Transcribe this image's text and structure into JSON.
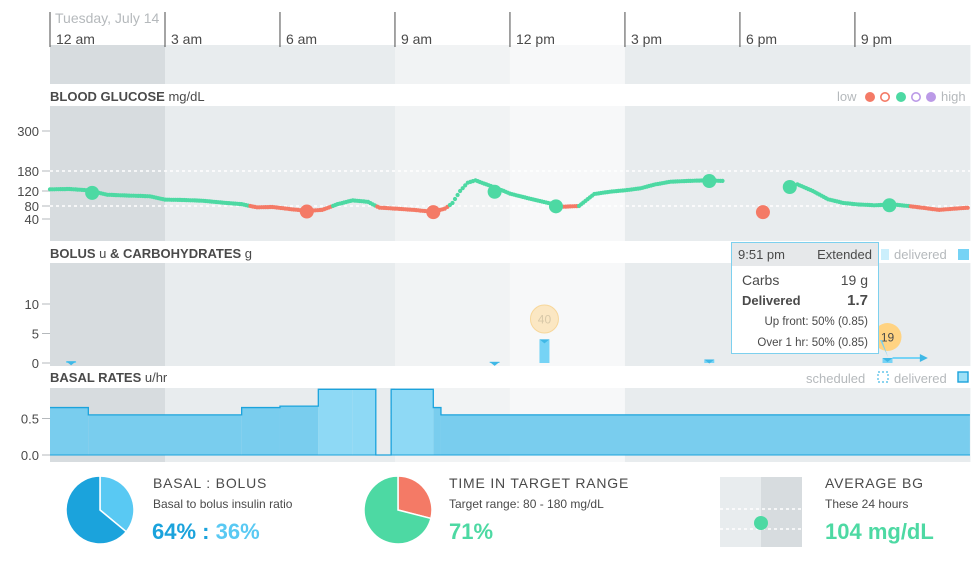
{
  "date": "Tuesday, July 14",
  "time_ticks": [
    "12 am",
    "3 am",
    "6 am",
    "9 am",
    "12 pm",
    "3 pm",
    "6 pm",
    "9 pm"
  ],
  "colors": {
    "in_range": "#4dd9a3",
    "low": "#f47a66",
    "high": "#bb9ae7",
    "bolus": "#76d3f5",
    "basal": "#66c6ea",
    "carbs": "#ffd382",
    "shade_dark": "#d7dcdf",
    "shade_mid": "#e8ecee",
    "shade_light": "#f1f3f4",
    "shade_lightest": "#f7f8f9"
  },
  "bg_panel": {
    "title": "BLOOD GLUCOSE",
    "unit": "mg/dL",
    "legend_low": "low",
    "legend_high": "high",
    "ticks": [
      "300",
      "180",
      "120",
      "80",
      "40"
    ]
  },
  "bolus_panel": {
    "title": "BOLUS",
    "unit_u": "u",
    "title2": "& CARBOHYDRATES",
    "unit_g": "g",
    "legend_delivered": "delivered",
    "ticks": [
      "10",
      "5",
      "0"
    ]
  },
  "basal_panel": {
    "title": "BASAL RATES",
    "unit": "u/hr",
    "legend_scheduled": "scheduled",
    "legend_delivered": "delivered",
    "ticks": [
      "0.5",
      "0.0"
    ]
  },
  "tooltip": {
    "time": "9:51 pm",
    "type": "Extended",
    "carbs_label": "Carbs",
    "carbs_value": "19 g",
    "delivered_label": "Delivered",
    "delivered_value": "1.7",
    "upfront": "Up front: 50% (0.85)",
    "over": "Over 1 hr: 50% (0.85)"
  },
  "stats": {
    "basal_bolus": {
      "title": "BASAL : BOLUS",
      "subtitle": "Basal to bolus insulin ratio",
      "basal_pct": "64%",
      "sep": " : ",
      "bolus_pct": "36%",
      "basal_value": 64,
      "bolus_value": 36
    },
    "target": {
      "title": "TIME IN TARGET RANGE",
      "subtitle": "Target range: 80 - 180 mg/dL",
      "value_text": "71%",
      "in_range": 71,
      "out_range": 29
    },
    "average": {
      "title": "AVERAGE BG",
      "subtitle": "These 24 hours",
      "value_text": "104 mg/dL",
      "value": 104
    }
  },
  "chart_data": [
    {
      "type": "scatter",
      "title": "BLOOD GLUCOSE mg/dL",
      "x_unit": "hours since 12 am",
      "ylim": [
        40,
        300
      ],
      "target_lines": [
        80,
        180
      ],
      "smbg": [
        {
          "x": 1.1,
          "y": 115,
          "cls": "target"
        },
        {
          "x": 6.7,
          "y": 63,
          "cls": "low"
        },
        {
          "x": 10.0,
          "y": 61,
          "cls": "low"
        },
        {
          "x": 11.6,
          "y": 118,
          "cls": "target"
        },
        {
          "x": 13.2,
          "y": 79,
          "cls": "target"
        },
        {
          "x": 17.2,
          "y": 150,
          "cls": "target"
        },
        {
          "x": 18.6,
          "y": 61,
          "cls": "low"
        },
        {
          "x": 19.3,
          "y": 132,
          "cls": "target"
        },
        {
          "x": 21.9,
          "y": 82,
          "cls": "target"
        }
      ],
      "cbg": [
        {
          "x": 0.0,
          "y": 125
        },
        {
          "x": 0.5,
          "y": 126
        },
        {
          "x": 1.0,
          "y": 122
        },
        {
          "x": 1.5,
          "y": 110
        },
        {
          "x": 2.0,
          "y": 108
        },
        {
          "x": 2.6,
          "y": 106
        },
        {
          "x": 3.0,
          "y": 97
        },
        {
          "x": 3.5,
          "y": 96
        },
        {
          "x": 4.0,
          "y": 94
        },
        {
          "x": 4.5,
          "y": 89
        },
        {
          "x": 5.0,
          "y": 85
        },
        {
          "x": 5.4,
          "y": 76
        },
        {
          "x": 5.8,
          "y": 77
        },
        {
          "x": 6.3,
          "y": 70
        },
        {
          "x": 6.7,
          "y": 65
        },
        {
          "x": 7.1,
          "y": 68
        },
        {
          "x": 7.5,
          "y": 85
        },
        {
          "x": 7.9,
          "y": 95
        },
        {
          "x": 8.3,
          "y": 91
        },
        {
          "x": 8.6,
          "y": 75
        },
        {
          "x": 9.0,
          "y": 72
        },
        {
          "x": 9.5,
          "y": 68
        },
        {
          "x": 10.0,
          "y": 62
        },
        {
          "x": 10.3,
          "y": 72
        },
        {
          "x": 10.5,
          "y": 88
        },
        {
          "x": 10.7,
          "y": 120
        },
        {
          "x": 10.9,
          "y": 145
        },
        {
          "x": 11.1,
          "y": 152
        },
        {
          "x": 11.5,
          "y": 135
        },
        {
          "x": 12.0,
          "y": 113
        },
        {
          "x": 12.5,
          "y": 100
        },
        {
          "x": 13.0,
          "y": 88
        },
        {
          "x": 13.4,
          "y": 78
        },
        {
          "x": 13.8,
          "y": 80
        },
        {
          "x": 14.2,
          "y": 112
        },
        {
          "x": 14.6,
          "y": 118
        },
        {
          "x": 15.0,
          "y": 122
        },
        {
          "x": 15.4,
          "y": 128
        },
        {
          "x": 15.8,
          "y": 140
        },
        {
          "x": 16.2,
          "y": 148
        },
        {
          "x": 16.6,
          "y": 150
        },
        {
          "x": 17.1,
          "y": 152
        },
        {
          "x": 17.6,
          "y": 150
        },
        {
          "x": 19.5,
          "y": 140
        },
        {
          "x": 19.9,
          "y": 120
        },
        {
          "x": 20.3,
          "y": 98
        },
        {
          "x": 20.7,
          "y": 88
        },
        {
          "x": 21.1,
          "y": 84
        },
        {
          "x": 21.5,
          "y": 82
        },
        {
          "x": 22.0,
          "y": 84
        },
        {
          "x": 22.4,
          "y": 80
        },
        {
          "x": 22.8,
          "y": 74
        },
        {
          "x": 23.2,
          "y": 68
        },
        {
          "x": 23.6,
          "y": 72
        },
        {
          "x": 24.0,
          "y": 75
        }
      ]
    },
    {
      "type": "bar",
      "title": "BOLUS u & CARBOHYDRATES g",
      "ylim": [
        0,
        10
      ],
      "boluses": [
        {
          "x": 0.55,
          "value": 0.3
        },
        {
          "x": 11.6,
          "value": 0.2
        },
        {
          "x": 12.9,
          "value": 4.0
        },
        {
          "x": 17.2,
          "value": 0.6
        },
        {
          "x": 21.85,
          "value": 0.85,
          "extended_to": 22.85
        }
      ],
      "carbs": [
        {
          "x": 12.9,
          "grams": 40
        },
        {
          "x": 21.85,
          "grams": 19
        }
      ]
    },
    {
      "type": "area",
      "title": "BASAL RATES u/hr",
      "ylim": [
        0,
        1.0
      ],
      "delivered": [
        {
          "start": 0.0,
          "end": 1.0,
          "rate": 0.65
        },
        {
          "start": 1.0,
          "end": 5.0,
          "rate": 0.55
        },
        {
          "start": 5.0,
          "end": 6.0,
          "rate": 0.65
        },
        {
          "start": 6.0,
          "end": 7.0,
          "rate": 0.67
        },
        {
          "start": 7.0,
          "end": 7.9,
          "rate": 0.9
        },
        {
          "start": 7.9,
          "end": 8.5,
          "rate": 0.9
        },
        {
          "start": 8.5,
          "end": 8.9,
          "rate": 0.0
        },
        {
          "start": 8.9,
          "end": 10.0,
          "rate": 0.9
        },
        {
          "start": 10.0,
          "end": 10.2,
          "rate": 0.65
        },
        {
          "start": 10.2,
          "end": 24.0,
          "rate": 0.55
        }
      ]
    },
    {
      "type": "pie",
      "title": "BASAL : BOLUS",
      "labels": [
        "basal",
        "bolus"
      ],
      "values": [
        64,
        36
      ]
    },
    {
      "type": "pie",
      "title": "TIME IN TARGET RANGE",
      "labels": [
        "in range",
        "low"
      ],
      "values": [
        71,
        29
      ]
    }
  ]
}
